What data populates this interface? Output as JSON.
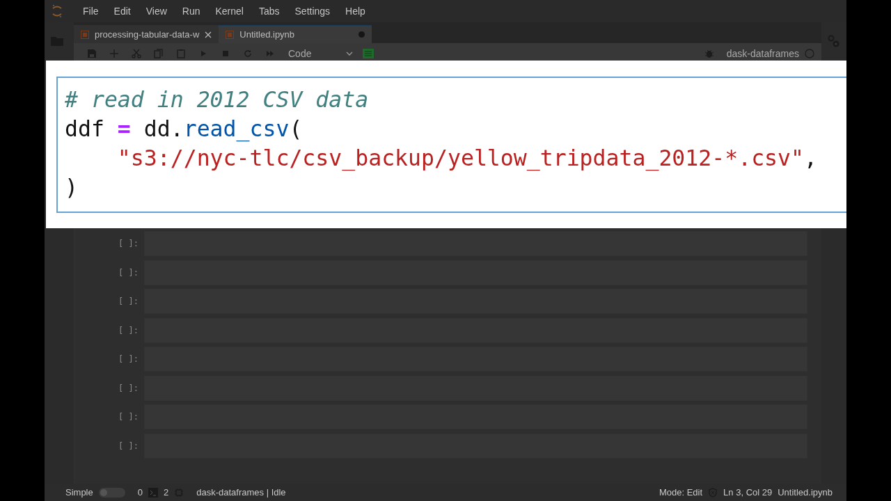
{
  "menu": [
    "File",
    "Edit",
    "View",
    "Run",
    "Kernel",
    "Tabs",
    "Settings",
    "Help"
  ],
  "tabs": [
    {
      "label": "processing-tabular-data-w",
      "selected": false,
      "closable": true,
      "unsaved": false
    },
    {
      "label": "Untitled.ipynb",
      "selected": true,
      "closable": false,
      "unsaved": true
    }
  ],
  "toolbar": {
    "cell_type": "Code",
    "kernel": {
      "name": "dask-dataframes",
      "busy": false
    }
  },
  "code_cell": {
    "lines": [
      {
        "indented": false,
        "tokens": [
          {
            "kind": "comment",
            "text": "# read in 2012 CSV data"
          }
        ]
      },
      {
        "indented": false,
        "tokens": [
          {
            "kind": "plain",
            "text": "ddf "
          },
          {
            "kind": "operator",
            "text": "="
          },
          {
            "kind": "plain",
            "text": " dd."
          },
          {
            "kind": "function",
            "text": "read_csv"
          },
          {
            "kind": "plain",
            "text": "("
          }
        ]
      },
      {
        "indented": true,
        "tokens": [
          {
            "kind": "string",
            "text": "\"s3://nyc-tlc/csv_backup/yellow_tripdata_2012-*.csv\""
          },
          {
            "kind": "plain",
            "text": ","
          }
        ]
      },
      {
        "indented": false,
        "tokens": [
          {
            "kind": "plain",
            "text": ")"
          }
        ]
      }
    ]
  },
  "cells": [
    {
      "prompt": "[ ]:"
    },
    {
      "prompt": "[ ]:"
    },
    {
      "prompt": "[ ]:"
    },
    {
      "prompt": "[ ]:"
    },
    {
      "prompt": "[ ]:"
    },
    {
      "prompt": "[ ]:"
    },
    {
      "prompt": "[ ]:"
    },
    {
      "prompt": "[ ]:"
    }
  ],
  "status_bar": {
    "simple_label": "Simple",
    "simple_on": false,
    "terminals": "0",
    "kernels": "2",
    "kernel_status": "dask-dataframes | Idle",
    "mode": "Mode: Edit",
    "position": "Ln 3, Col 29",
    "file": "Untitled.ipynb"
  }
}
